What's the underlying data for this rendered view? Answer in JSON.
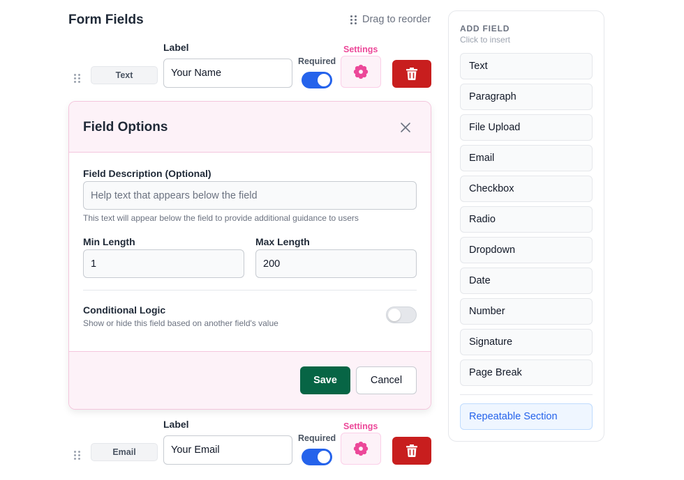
{
  "header": {
    "title": "Form Fields",
    "drag_hint": "Drag to reorder"
  },
  "fields": [
    {
      "type": "Text",
      "label_caption": "Label",
      "label_value": "Your Name",
      "required_caption": "Required",
      "required": true,
      "settings_caption": "Settings"
    },
    {
      "type": "Email",
      "label_caption": "Label",
      "label_value": "Your Email",
      "required_caption": "Required",
      "required": true,
      "settings_caption": "Settings"
    }
  ],
  "options": {
    "title": "Field Options",
    "description_label": "Field Description (Optional)",
    "description_placeholder": "Help text that appears below the field",
    "description_value": "",
    "description_help": "This text will appear below the field to provide additional guidance to users",
    "min_label": "Min Length",
    "min_value": "1",
    "max_label": "Max Length",
    "max_value": "200",
    "logic_title": "Conditional Logic",
    "logic_help": "Show or hide this field based on another field's value",
    "logic_enabled": false,
    "save_label": "Save",
    "cancel_label": "Cancel"
  },
  "add_field": {
    "title": "ADD FIELD",
    "subtitle": "Click to insert",
    "items": [
      "Text",
      "Paragraph",
      "File Upload",
      "Email",
      "Checkbox",
      "Radio",
      "Dropdown",
      "Date",
      "Number",
      "Signature",
      "Page Break"
    ],
    "repeatable_label": "Repeatable Section"
  },
  "colors": {
    "accent_blue": "#2563eb",
    "settings_pink": "#ec4899",
    "delete_red": "#c81e1e",
    "save_green": "#076545"
  },
  "icons": {
    "drag": "drag-handle-icon",
    "settings": "gear-icon",
    "delete": "trash-icon",
    "close": "close-icon"
  }
}
